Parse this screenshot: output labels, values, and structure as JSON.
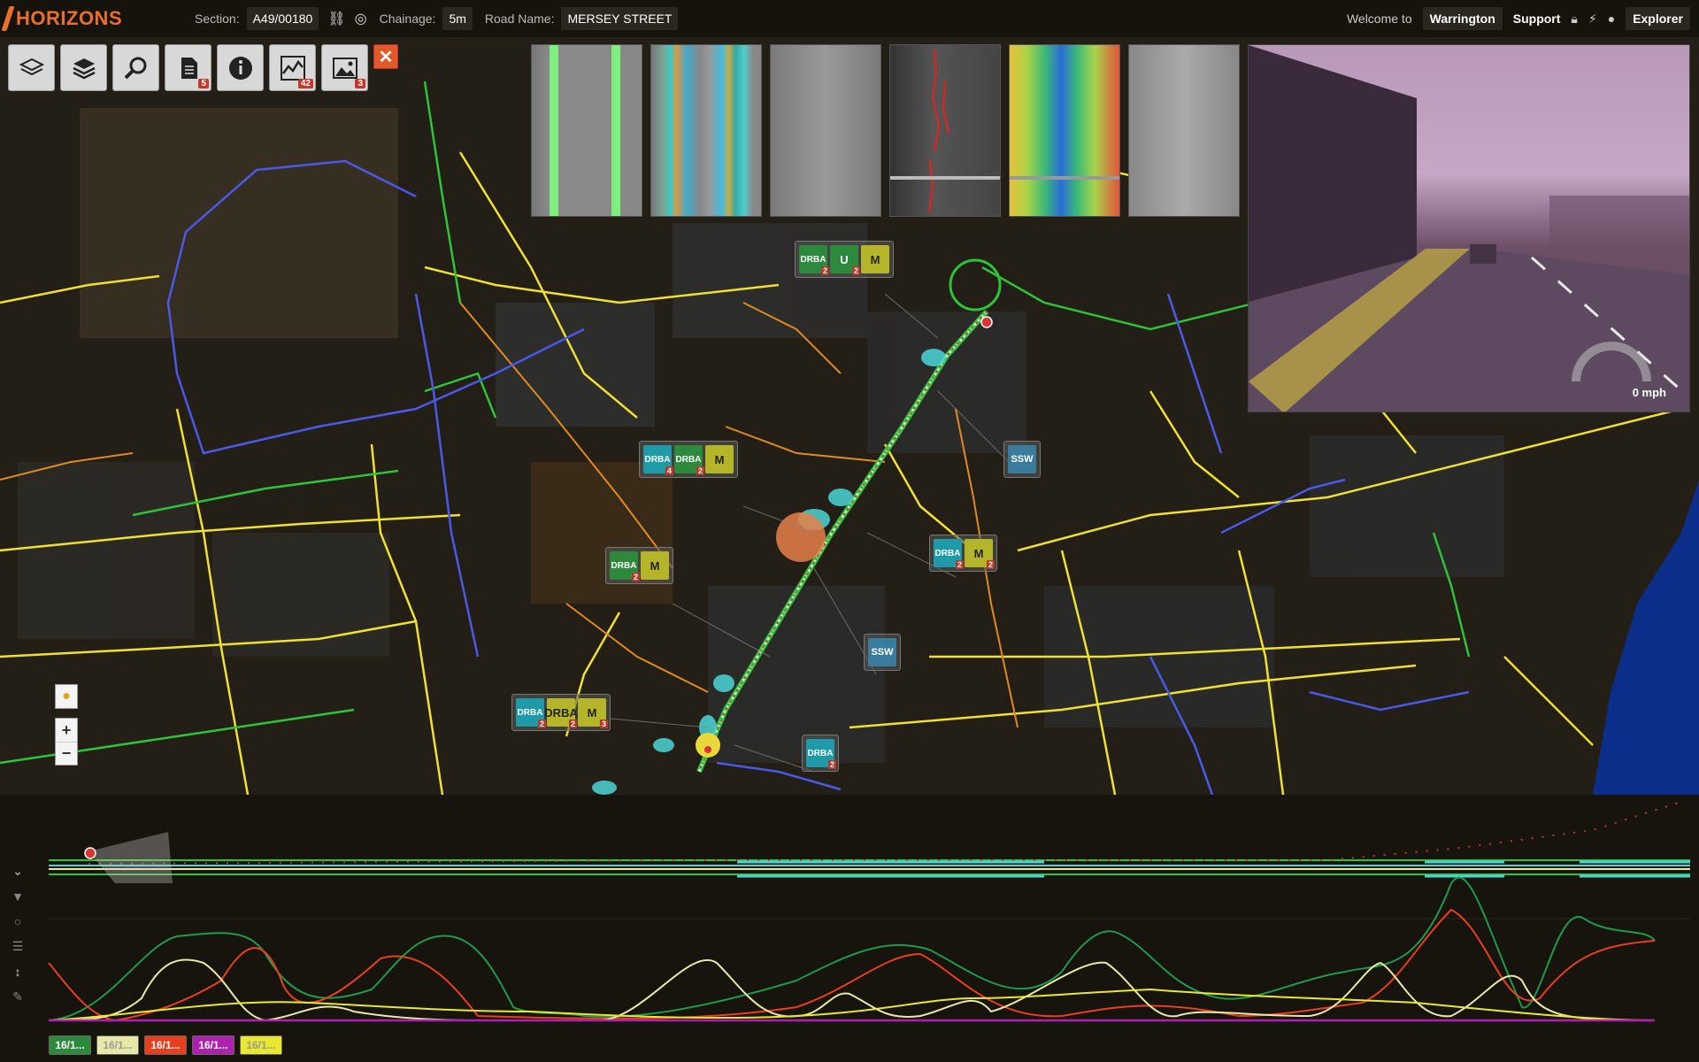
{
  "app": {
    "logo": "HORIZONS"
  },
  "header": {
    "section_label": "Section:",
    "section_value": "A49/00180",
    "chainage_label": "Chainage:",
    "chainage_value": "5m",
    "road_name_label": "Road Name:",
    "road_name_value": "MERSEY STREET",
    "welcome": "Welcome to",
    "org": "Warrington",
    "support": "Support",
    "explorer": "Explorer"
  },
  "toolbar": {
    "tools": [
      {
        "name": "layers-icon",
        "badge": ""
      },
      {
        "name": "layers-stack-icon",
        "badge": ""
      },
      {
        "name": "search-icon",
        "badge": ""
      },
      {
        "name": "document-icon",
        "badge": "5"
      },
      {
        "name": "info-icon",
        "badge": ""
      },
      {
        "name": "chart-icon",
        "badge": "42"
      },
      {
        "name": "image-icon",
        "badge": "3"
      }
    ],
    "close": "✕"
  },
  "video": {
    "speed": "0 mph"
  },
  "markers": [
    {
      "id": "m1",
      "chips": [
        {
          "label": "DRBA",
          "color": "green",
          "n": "2"
        },
        {
          "label": "U",
          "color": "green",
          "n": "2"
        },
        {
          "label": "M",
          "color": "olive",
          "n": ""
        }
      ]
    },
    {
      "id": "m2",
      "chips": [
        {
          "label": "DRBA",
          "color": "teal",
          "n": "4"
        },
        {
          "label": "DRBA",
          "color": "green",
          "n": "2"
        },
        {
          "label": "M",
          "color": "olive",
          "n": ""
        }
      ]
    },
    {
      "id": "m3",
      "chips": [
        {
          "label": "SSW",
          "color": "blue",
          "n": ""
        }
      ]
    },
    {
      "id": "m4",
      "chips": [
        {
          "label": "DRBA",
          "color": "green",
          "n": "2"
        },
        {
          "label": "M",
          "color": "olive",
          "n": ""
        }
      ]
    },
    {
      "id": "m5",
      "chips": [
        {
          "label": "DRBA",
          "color": "teal",
          "n": "2"
        },
        {
          "label": "M",
          "color": "olive",
          "n": "2"
        }
      ]
    },
    {
      "id": "m6",
      "chips": [
        {
          "label": "SSW",
          "color": "blue",
          "n": ""
        }
      ]
    },
    {
      "id": "m7",
      "chips": [
        {
          "label": "DRBA",
          "color": "teal",
          "n": "2"
        },
        {
          "label": "DRBA",
          "color": "olive",
          "n": "2"
        },
        {
          "label": "M",
          "color": "olive",
          "n": "3"
        }
      ]
    },
    {
      "id": "m8",
      "chips": [
        {
          "label": "DRBA",
          "color": "teal",
          "n": "2"
        }
      ]
    }
  ],
  "zoom": {
    "in": "+",
    "out": "−"
  },
  "legend": [
    {
      "label": "16/1...",
      "bg": "#2d8a3c",
      "fg": "#ffffff"
    },
    {
      "label": "16/1...",
      "bg": "#e8e8a8",
      "fg": "#999999"
    },
    {
      "label": "16/1...",
      "bg": "#e8401e",
      "fg": "#ffffff"
    },
    {
      "label": "16/1...",
      "bg": "#b020b0",
      "fg": "#ffffff"
    },
    {
      "label": "16/1...",
      "bg": "#e8e830",
      "fg": "#999999"
    }
  ],
  "colors": {
    "accent": "#e8702a",
    "road_yellow": "#f0e030",
    "road_green": "#2ec43a",
    "road_blue": "#4a5ae8",
    "road_orange": "#e08a20"
  }
}
